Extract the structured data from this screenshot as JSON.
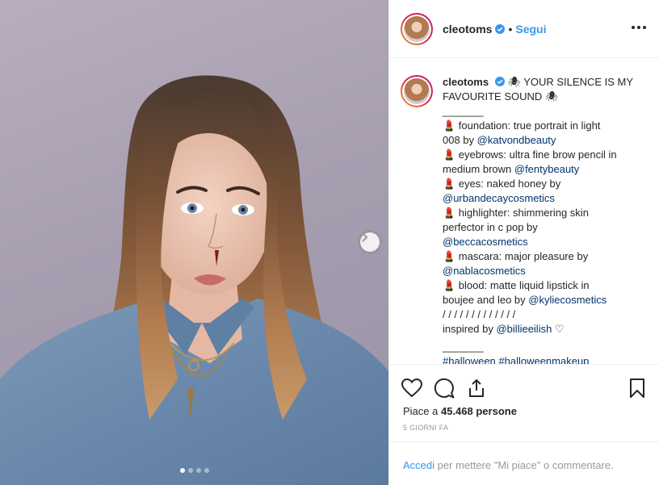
{
  "post": {
    "username": "cleotoms",
    "follow_label": "Segui",
    "separator": "•",
    "verified_icon": "verified-badge-icon",
    "photo": {
      "description_icon": "portrait-photo",
      "carousel_count": 4,
      "carousel_active_index": 0
    }
  },
  "caption": {
    "username": "cleotoms",
    "line1": "🕷 YOUR SILENCE IS MY",
    "line2": "FAVOURITE SOUND 🕷",
    "divider1": "_______",
    "items": [
      {
        "l1": "💄 foundation: true portrait in light",
        "l2_text": "008 by ",
        "l2_mention": "@katvondbeauty"
      },
      {
        "l1": "💄 eyebrows: ultra fine brow pencil in",
        "l2_text": "medium brown ",
        "l2_mention": "@fentybeauty"
      },
      {
        "l1": "💄 eyes: naked honey by",
        "l2_text": "",
        "l2_mention": "@urbandecaycosmetics"
      },
      {
        "l1": "💄 highlighter: shimmering skin",
        "l2_text": "perfector in c pop by",
        "l2_mention": ""
      },
      {
        "l1": "",
        "l2_text": "",
        "l2_mention": "@beccacosmetics"
      },
      {
        "l1": "💄 mascara: major pleasure by",
        "l2_text": "",
        "l2_mention": "@nablacosmetics"
      },
      {
        "l1": "💄 blood: matte liquid lipstick in",
        "l2_text": "boujee and leo by ",
        "l2_mention": "@kyliecosmetics"
      }
    ],
    "slashes": "/ / / / / / / / / / / / /",
    "inspired_text": "inspired by ",
    "inspired_mention": "@billieeilish",
    "inspired_heart": " ♡",
    "divider2": "_______",
    "hashtags": "#halloween #halloweenmakeup"
  },
  "actions": {
    "like_icon": "heart-icon",
    "comment_icon": "comment-icon",
    "share_icon": "share-icon",
    "save_icon": "bookmark-icon",
    "likes_prefix": "Piace a ",
    "likes_count": "45.468 persone",
    "time": "5 GIORNI FA",
    "login_link": "Accedi",
    "login_rest": " per mettere \"Mi piace\" o commentare."
  },
  "colors": {
    "link_blue": "#3897f0",
    "mention_blue": "#003569",
    "text": "#262626",
    "muted": "#999999"
  }
}
